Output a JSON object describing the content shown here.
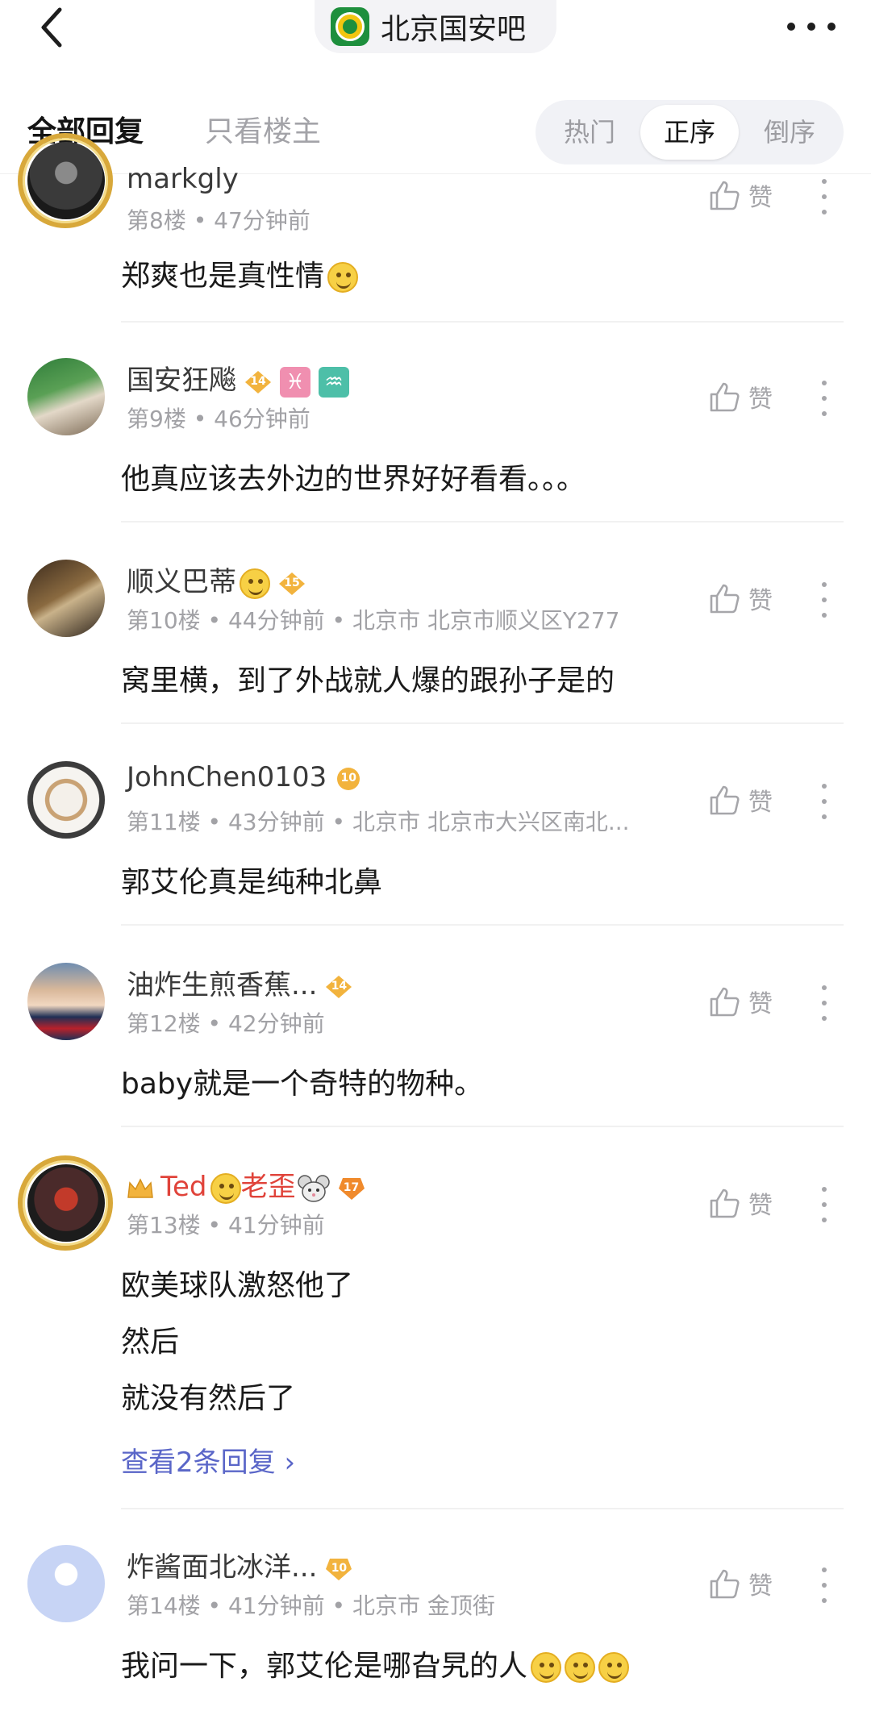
{
  "topbar": {
    "forum_name": "北京国安吧",
    "back_icon": "chevron-left-icon",
    "more_icon": "more-dots-icon"
  },
  "tabs": {
    "all_replies": "全部回复",
    "op_only": "只看楼主",
    "sort": {
      "hot": "热门",
      "ascending": "正序",
      "descending": "倒序",
      "selected": "正序"
    }
  },
  "like_label": "赞",
  "colors": {
    "accent_link": "#5a66c8",
    "vip_name": "#e0433a",
    "level_badge": "#f2b33d"
  },
  "comments": [
    {
      "username": "markgly",
      "floor": "第8楼",
      "time": "47分钟前",
      "location": "",
      "level": "",
      "lines": [
        "郑爽也是真性情"
      ]
    },
    {
      "username": "国安狂飚",
      "floor": "第9楼",
      "time": "46分钟前",
      "location": "",
      "level": "14",
      "lines": [
        "他真应该去外边的世界好好看看。。。"
      ]
    },
    {
      "username": "顺义巴蒂",
      "floor": "第10楼",
      "time": "44分钟前",
      "location": "北京市 北京市顺义区Y277",
      "level": "15",
      "lines": [
        "窝里横，到了外战就人爆的跟孙子是的"
      ]
    },
    {
      "username": "JohnChen0103",
      "floor": "第11楼",
      "time": "43分钟前",
      "location": "北京市 北京市大兴区南北...",
      "level": "10",
      "lines": [
        "郭艾伦真是纯种北鼻"
      ]
    },
    {
      "username": "油炸生煎香蕉...",
      "floor": "第12楼",
      "time": "42分钟前",
      "location": "",
      "level": "14",
      "lines": [
        "baby就是一个奇特的物种。"
      ]
    },
    {
      "username_parts": [
        "Ted",
        "老歪"
      ],
      "floor": "第13楼",
      "time": "41分钟前",
      "location": "",
      "level": "17",
      "lines": [
        "欧美球队激怒他了",
        "然后",
        "就没有然后了"
      ],
      "reply_link": "查看2条回复"
    },
    {
      "username": "炸酱面北冰洋...",
      "floor": "第14楼",
      "time": "41分钟前",
      "location": "北京市 金顶街",
      "level": "10",
      "lines": [
        "我问一下，郭艾伦是哪旮旯的人"
      ]
    }
  ]
}
